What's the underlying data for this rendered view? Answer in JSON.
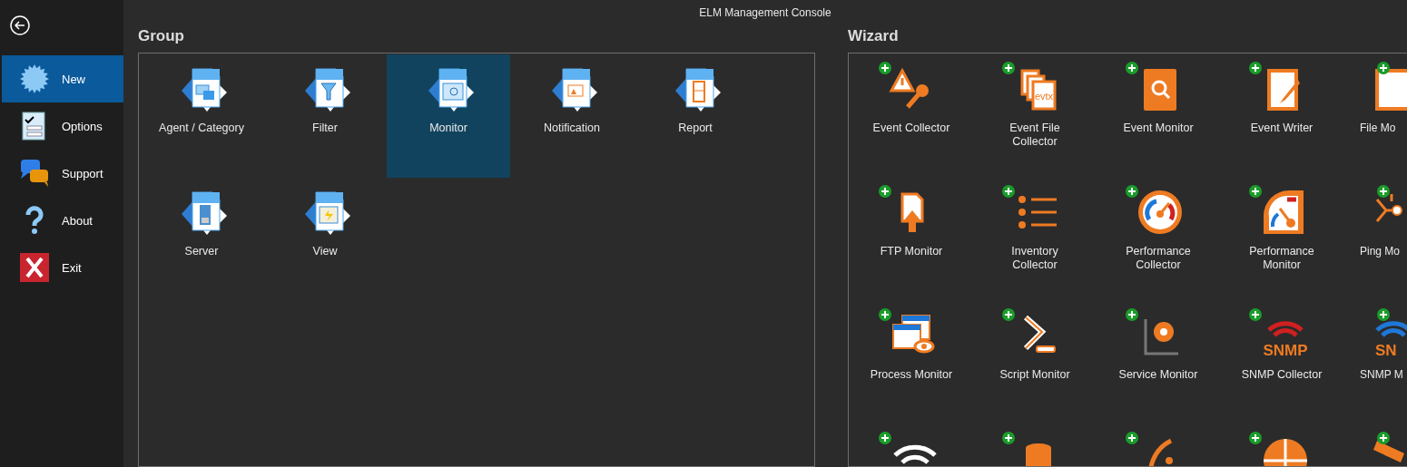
{
  "window": {
    "title": "ELM Management Console"
  },
  "sidebar": {
    "items": [
      {
        "label": "New",
        "selected": true
      },
      {
        "label": "Options",
        "selected": false
      },
      {
        "label": "Support",
        "selected": false
      },
      {
        "label": "About",
        "selected": false
      },
      {
        "label": "Exit",
        "selected": false
      }
    ]
  },
  "group": {
    "title": "Group",
    "items": [
      {
        "label": "Agent / Category",
        "selected": false
      },
      {
        "label": "Filter",
        "selected": false
      },
      {
        "label": "Monitor",
        "selected": true
      },
      {
        "label": "Notification",
        "selected": false
      },
      {
        "label": "Report",
        "selected": false
      },
      {
        "label": "Server",
        "selected": false
      },
      {
        "label": "View",
        "selected": false
      }
    ]
  },
  "wizard": {
    "title": "Wizard",
    "items": [
      {
        "label": "Event Collector",
        "badge": true
      },
      {
        "label": "Event File Collector",
        "icon_text": "evtx",
        "badge": true
      },
      {
        "label": "Event Monitor",
        "badge": true
      },
      {
        "label": "Event Writer",
        "badge": true
      },
      {
        "label": "File Mo",
        "badge": true
      },
      {
        "label": "FTP Monitor",
        "badge": true
      },
      {
        "label": "Inventory Collector",
        "badge": true
      },
      {
        "label": "Performance Collector",
        "badge": true
      },
      {
        "label": "Performance Monitor",
        "badge": true
      },
      {
        "label": "Ping Mo",
        "badge": true
      },
      {
        "label": "Process Monitor",
        "badge": true
      },
      {
        "label": "Script Monitor",
        "badge": true
      },
      {
        "label": "Service Monitor",
        "badge": true
      },
      {
        "label": "SNMP Collector",
        "icon_text": "SNMP",
        "badge": true
      },
      {
        "label": "SNMP M",
        "icon_text": "SN",
        "badge": true
      },
      {
        "badge": true
      },
      {
        "badge": true
      },
      {
        "badge": true
      },
      {
        "badge": true
      },
      {
        "badge": true
      }
    ]
  }
}
